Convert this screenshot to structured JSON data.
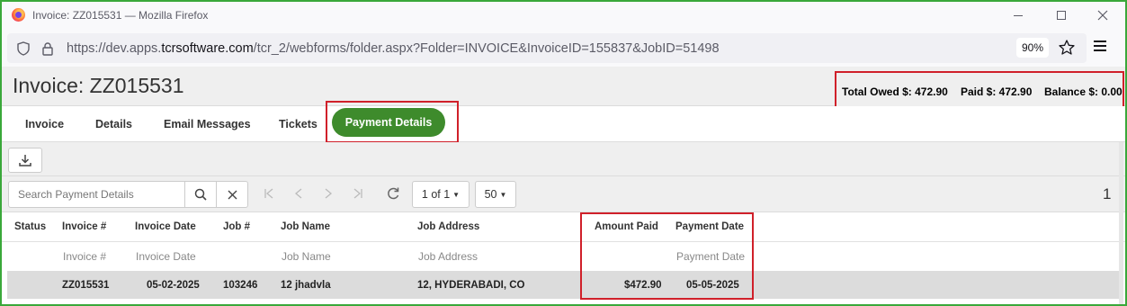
{
  "browser": {
    "window_title": "Invoice: ZZ015531 — Mozilla Firefox",
    "url_prefix": "https://dev.apps.",
    "url_host": "tcrsoftware.com",
    "url_path": "/tcr_2/webforms/folder.aspx?Folder=INVOICE&InvoiceID=155837&JobID=51498",
    "zoom": "90%"
  },
  "header": {
    "title": "Invoice: ZZ015531",
    "total_owed": "Total Owed $: 472.90",
    "paid": "Paid $: 472.90",
    "balance": "Balance $: 0.00"
  },
  "tabs": [
    {
      "label": "Invoice"
    },
    {
      "label": "Details"
    },
    {
      "label": "Email Messages"
    },
    {
      "label": "Tickets"
    },
    {
      "label": "Payment Details",
      "active": true
    }
  ],
  "toolbar": {
    "search_placeholder": "Search Payment Details",
    "page_select": "1 of 1",
    "page_size": "50",
    "record_count": "1"
  },
  "table": {
    "columns": [
      "Status",
      "Invoice #",
      "Invoice Date",
      "Job #",
      "Job Name",
      "Job Address",
      "Amount Paid",
      "Payment Date"
    ],
    "filters": {
      "invoice_no": "Invoice #",
      "invoice_date": "Invoice Date",
      "job_name": "Job Name",
      "job_address": "Job Address",
      "payment_date": "Payment Date"
    },
    "rows": [
      {
        "status": "",
        "invoice_no": "ZZ015531",
        "invoice_date": "05-02-2025",
        "job_no": "103246",
        "job_name": "12 jhadvla",
        "job_address": "12, HYDERABADI, CO",
        "amount_paid": "$472.90",
        "payment_date": "05-05-2025"
      }
    ]
  },
  "colors": {
    "accent_green": "#3e8b2c",
    "highlight_red": "#d0202a",
    "frame_green": "#3aa83a"
  }
}
